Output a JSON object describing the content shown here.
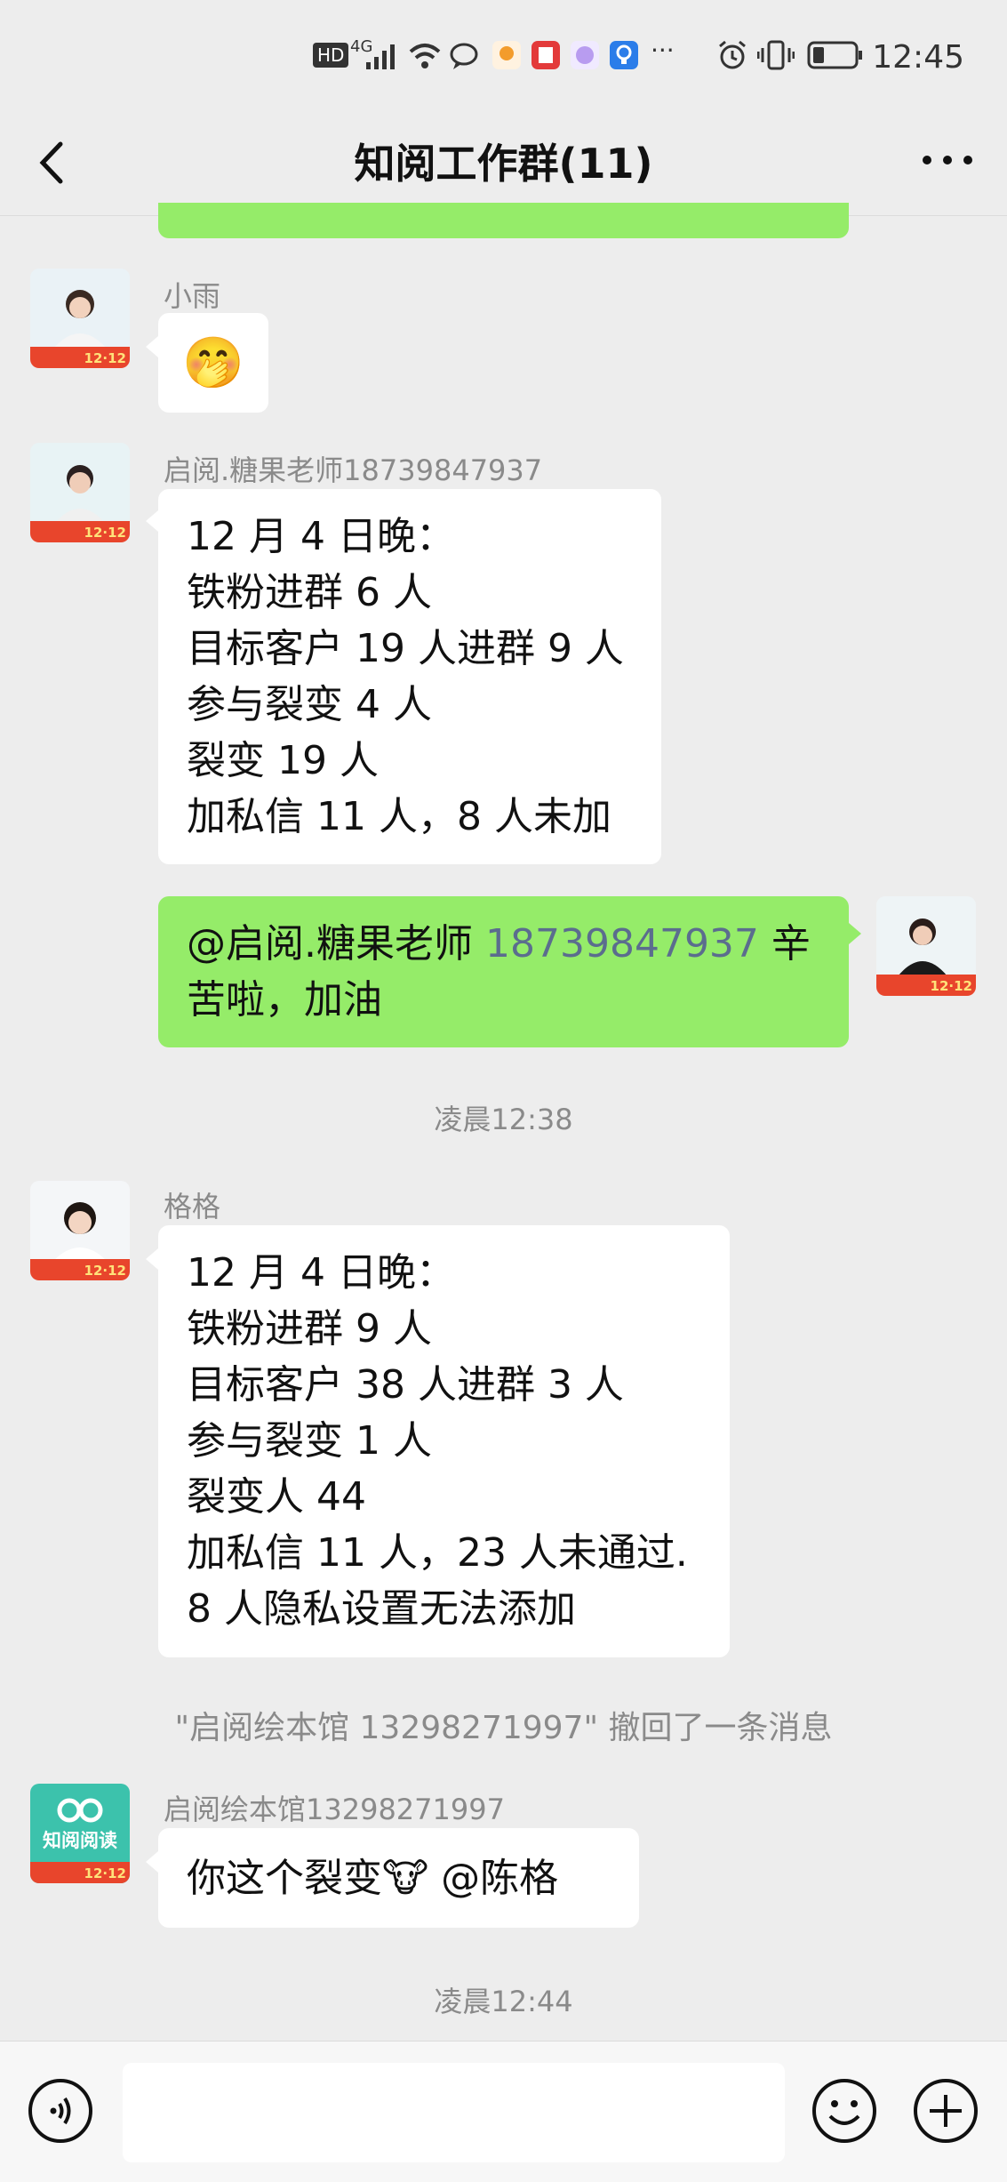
{
  "status_bar": {
    "hd": "HD",
    "network": "4G",
    "overflow": "···",
    "time": "12:45"
  },
  "nav": {
    "title": "知阅工作群(11)"
  },
  "messages": [
    {
      "sender": "小雨",
      "emoji": "🤭"
    },
    {
      "sender": "启阅.糖果老师18739847937",
      "lines": [
        "12 月 4 日晚：",
        "铁粉进群 6 人",
        "目标客户 19 人进群 9 人",
        "参与裂变 4 人",
        "裂变 19 人",
        "加私信 11 人，8 人未加"
      ]
    },
    {
      "mine": true,
      "line1_prefix": "@启阅.糖果老师 ",
      "line1_number": "18739847937",
      "line1_suffix": " 辛",
      "line2": "苦啦，加油"
    },
    {
      "sender": "格格",
      "lines": [
        "12 月 4 日晚：",
        "铁粉进群 9 人",
        "目标客户 38 人进群 3 人",
        "参与裂变 1 人",
        "裂变人 44",
        "加私信 11 人，23 人未通过.",
        "8 人隐私设置无法添加"
      ]
    },
    {
      "sender": "启阅绘本馆13298271997",
      "text_prefix": "你这个裂变",
      "emoji": "🐮",
      "text_suffix": " @陈格"
    }
  ],
  "timestamps": [
    "凌晨12:38",
    "凌晨12:44"
  ],
  "system_notice": "\"启阅绘本馆 13298271997\" 撤回了一条消息",
  "avatar_banner": "12·12",
  "brand_avatar_text": "知阅阅读",
  "colors": {
    "accent_green": "#95ec69",
    "banner_red": "#e8452c",
    "brand_teal": "#3cc2ac"
  }
}
